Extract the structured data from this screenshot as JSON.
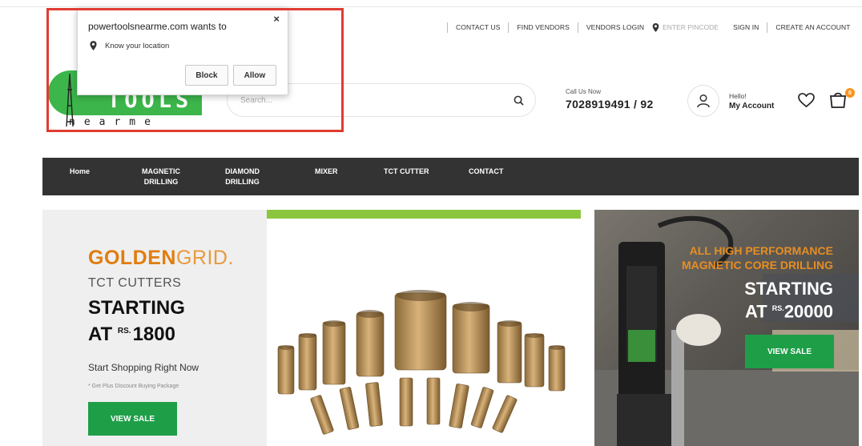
{
  "utility_links": {
    "contact_us": "CONTACT US",
    "find_vendors": "FIND VENDORS",
    "vendors_login": "VENDORS LOGIN",
    "pincode_placeholder": "ENTER PINCODE",
    "sign_in": "SIGN IN",
    "create_account": "CREATE AN ACCOUNT"
  },
  "logo": {
    "text": "TOOLS",
    "subtext": "nearme"
  },
  "search": {
    "placeholder": "Search..."
  },
  "call": {
    "label": "Call Us Now",
    "number": "7028919491 / 92"
  },
  "account": {
    "hello": "Hello!",
    "my_account": "My Account"
  },
  "cart": {
    "count": "0"
  },
  "nav": {
    "items": [
      {
        "label": "Home"
      },
      {
        "label": "MAGNETIC\nDRILLING"
      },
      {
        "label": "DIAMOND\nDRILLING"
      },
      {
        "label": "MIXER"
      },
      {
        "label": "TCT CUTTER"
      },
      {
        "label": "CONTACT"
      }
    ]
  },
  "banner_left": {
    "brand_bold": "GOLDEN",
    "brand_light": "GRID.",
    "subtitle": "TCT CUTTERS",
    "starting": "STARTING",
    "at": "AT",
    "currency": "RS.",
    "price": "1800",
    "shop_text": "Start Shopping Right Now",
    "note": "* Get Plus Discount Buying Package",
    "button": "VIEW SALE"
  },
  "banner_right": {
    "tagline_1": "ALL HIGH PERFORMANCE",
    "tagline_2": "MAGNETIC CORE DRILLING",
    "starting": "STARTING",
    "at": "AT",
    "currency": "RS.",
    "price": "20000",
    "button": "VIEW SALE"
  },
  "location_popup": {
    "title": "powertoolsnearme.com wants to",
    "permission": "Know your location",
    "block": "Block",
    "allow": "Allow",
    "close": "×"
  },
  "colors": {
    "brand_green": "#3cb54a",
    "nav_bg": "#333333",
    "button_green": "#1f9e48",
    "accent_orange": "#f7941d",
    "lime_bar": "#8cc63f",
    "highlight_red": "#e03c31"
  }
}
